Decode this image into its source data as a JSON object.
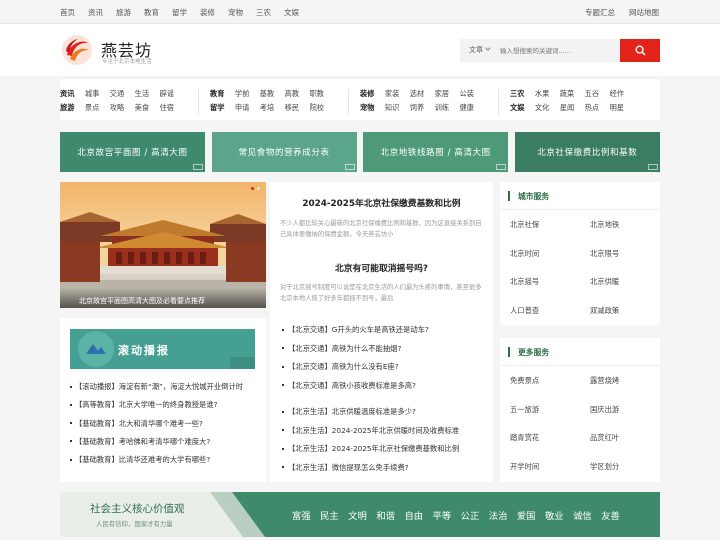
{
  "topbar": {
    "left": [
      "首页",
      "资讯",
      "旅游",
      "教育",
      "留学",
      "装修",
      "宠物",
      "三农",
      "文娱"
    ],
    "right": [
      "专题汇总",
      "网站地图"
    ]
  },
  "header": {
    "brand": "燕芸坊",
    "slogan": "专注于北京本地生活",
    "search": {
      "scope": "文章",
      "placeholder": "输入想搜索的关键词......"
    }
  },
  "nav": [
    {
      "rows": [
        [
          "资讯",
          "城事",
          "交通",
          "生活",
          "辟谣"
        ],
        [
          "旅游",
          "景点",
          "攻略",
          "美食",
          "住宿"
        ]
      ]
    },
    {
      "rows": [
        [
          "教育",
          "学前",
          "基教",
          "高教",
          "职教"
        ],
        [
          "留学",
          "申请",
          "考培",
          "移民",
          "院校"
        ]
      ]
    },
    {
      "rows": [
        [
          "装修",
          "家装",
          "选材",
          "家居",
          "公装"
        ],
        [
          "宠物",
          "知识",
          "饲养",
          "训练",
          "健康"
        ]
      ]
    },
    {
      "rows": [
        [
          "三农",
          "水果",
          "蔬菜",
          "五谷",
          "经作"
        ],
        [
          "文娱",
          "文化",
          "星闻",
          "热点",
          "明星"
        ]
      ]
    }
  ],
  "banners": [
    {
      "text": "北京故宫平面图 / 高清大图",
      "color": "#3f8a6c"
    },
    {
      "text": "常见食物的营养成分表",
      "color": "#5ba68a"
    },
    {
      "text": "北京地铁线路图 / 高清大图",
      "color": "#4e9a78"
    },
    {
      "text": "北京社保缴费比例和基数",
      "color": "#3b7d61"
    }
  ],
  "photo": {
    "caption": "北京故宫平面图高清大图及必看要点推荐"
  },
  "gundong": {
    "title": "滚动播报",
    "items": [
      "【滚动播报】海淀有新“潮”，海淀大悦城开业倒计时",
      "【高等教育】北京大学唯一的终身教授是谁?",
      "【基础教育】北大和清华哪个难考一些?",
      "【基础教育】考哈佛和考清华哪个难度大?",
      "【基础教育】比清华还难考的大学有哪些?"
    ]
  },
  "articles": {
    "a1": {
      "title": "2024-2025年北京社保缴费基数和比例",
      "desc": "不少人都比较关心最新的北京社保缴费比例和基数，因为这直接关系到自己具体要缴纳的保费金额，今天燕芸坊小"
    },
    "a2": {
      "title": "北京有可能取消摇号吗?",
      "desc": "对于北京摇号制度可以说是在北京生活的人们最为头疼的事情，甚至很多北京本地人摇了好多年都摇不到号，最后"
    },
    "list1": [
      "【北京交通】G开头的火车是高铁还是动车?",
      "【北京交通】高铁为什么不能抽烟?",
      "【北京交通】高铁为什么没有E座?",
      "【北京交通】高铁小孩收费标准是多高?"
    ],
    "list2": [
      "【北京生活】北京供暖温度标准是多少?",
      "【北京生活】2024-2025年北京供暖时间及收费标准",
      "【北京生活】2024-2025年北京社保缴费基数和比例",
      "【北京生活】微信提现怎么免手续费?"
    ]
  },
  "city": {
    "title": "城市服务",
    "items": [
      "北京社保",
      "北京地铁",
      "北京时间",
      "北京限号",
      "北京摇号",
      "北京供暖",
      "人口普查",
      "双减政策"
    ]
  },
  "more": {
    "title": "更多服务",
    "items": [
      "免费景点",
      "露营烧烤",
      "五一旅游",
      "国庆出游",
      "踏青赏花",
      "品赏红叶",
      "开学时间",
      "学区划分"
    ]
  },
  "footer": {
    "title": "社会主义核心价值观",
    "sub": "人民有信仰，国家才有力量",
    "values": [
      "富强",
      "民主",
      "文明",
      "和谐",
      "自由",
      "平等",
      "公正",
      "法治",
      "爱国",
      "敬业",
      "诚信",
      "友善"
    ]
  }
}
